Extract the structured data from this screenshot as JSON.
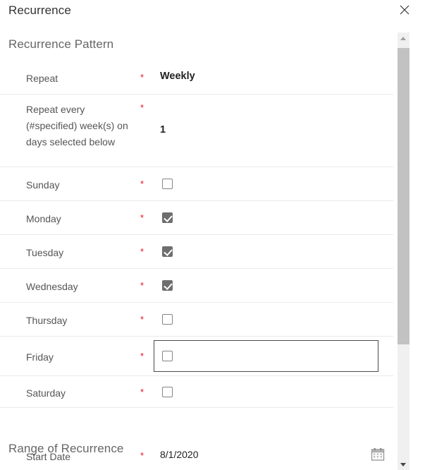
{
  "dialog": {
    "title": "Recurrence",
    "close_icon": "close-icon"
  },
  "sections": {
    "pattern_heading": "Recurrence Pattern",
    "range_heading": "Range of Recurrence"
  },
  "required_marker": "*",
  "fields": {
    "repeat": {
      "label": "Repeat",
      "value": "Weekly"
    },
    "repeat_every": {
      "label": "Repeat every (#specified) week(s) on days selected below",
      "value": "1"
    },
    "sunday": {
      "label": "Sunday",
      "checked": "false"
    },
    "monday": {
      "label": "Monday",
      "checked": "true"
    },
    "tuesday": {
      "label": "Tuesday",
      "checked": "true"
    },
    "wednesday": {
      "label": "Wednesday",
      "checked": "true"
    },
    "thursday": {
      "label": "Thursday",
      "checked": "false"
    },
    "friday": {
      "label": "Friday",
      "checked": "false",
      "focused": "true"
    },
    "saturday": {
      "label": "Saturday",
      "checked": "false"
    },
    "start_date": {
      "label": "Start Date",
      "value": "8/1/2020",
      "icon": "calendar-icon"
    }
  },
  "scrollbar": {
    "up_icon": "chevron-up-icon",
    "down_icon": "chevron-down-icon"
  },
  "colors": {
    "required_red": "#e81123",
    "checkbox_checked": "#6e6e6e",
    "divider": "#eaeaea",
    "scroll_thumb": "#c2c2c2"
  }
}
